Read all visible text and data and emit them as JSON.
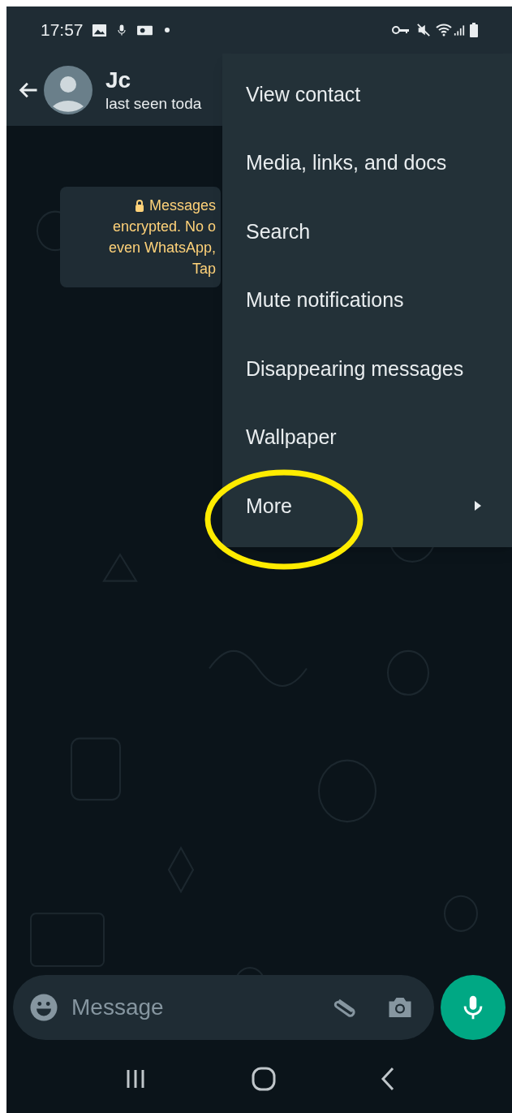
{
  "status_bar": {
    "time": "17:57"
  },
  "header": {
    "name": "Jc",
    "subtitle": "last seen toda"
  },
  "encryption_notice": {
    "lines": [
      "Messages",
      "encrypted. No o",
      "even WhatsApp,",
      "Tap"
    ]
  },
  "menu": {
    "items": [
      {
        "label": "View contact",
        "submenu": false,
        "highlighted": false
      },
      {
        "label": "Media, links, and docs",
        "submenu": false,
        "highlighted": false
      },
      {
        "label": "Search",
        "submenu": false,
        "highlighted": false
      },
      {
        "label": "Mute notifications",
        "submenu": false,
        "highlighted": false
      },
      {
        "label": "Disappearing messages",
        "submenu": false,
        "highlighted": false
      },
      {
        "label": "Wallpaper",
        "submenu": false,
        "highlighted": false
      },
      {
        "label": "More",
        "submenu": true,
        "highlighted": true
      }
    ]
  },
  "composer": {
    "placeholder": "Message"
  }
}
